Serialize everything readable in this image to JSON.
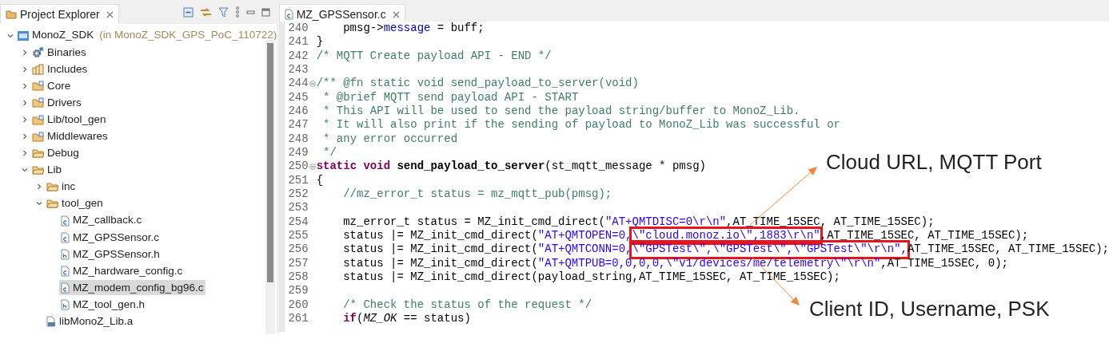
{
  "explorer": {
    "title": "Project Explorer",
    "tree": [
      {
        "name": "MonoZ_SDK",
        "location": "(in MonoZ_SDK_GPS_PoC_110722)",
        "kind": "project",
        "expanded": true,
        "selected": false,
        "children": [
          {
            "name": "Binaries",
            "kind": "binaries",
            "expanded": false,
            "selected": false
          },
          {
            "name": "Includes",
            "kind": "includes",
            "expanded": false,
            "selected": false
          },
          {
            "name": "Core",
            "kind": "sourcefolder",
            "expanded": false,
            "selected": false
          },
          {
            "name": "Drivers",
            "kind": "sourcefolder",
            "expanded": false,
            "selected": false
          },
          {
            "name": "Lib/tool_gen",
            "kind": "sourcefolder",
            "expanded": false,
            "selected": false
          },
          {
            "name": "Middlewares",
            "kind": "sourcefolder",
            "expanded": false,
            "selected": false
          },
          {
            "name": "Debug",
            "kind": "folder",
            "expanded": false,
            "selected": false
          },
          {
            "name": "Lib",
            "kind": "folder",
            "expanded": true,
            "selected": false,
            "children": [
              {
                "name": "inc",
                "kind": "folder",
                "expanded": false,
                "selected": false
              },
              {
                "name": "tool_gen",
                "kind": "folder",
                "expanded": true,
                "selected": false,
                "children": [
                  {
                    "name": "MZ_callback.c",
                    "kind": "source",
                    "selected": false
                  },
                  {
                    "name": "MZ_GPSSensor.c",
                    "kind": "source",
                    "selected": false
                  },
                  {
                    "name": "MZ_GPSSensor.h",
                    "kind": "header",
                    "selected": false
                  },
                  {
                    "name": "MZ_hardware_config.c",
                    "kind": "source",
                    "selected": false
                  },
                  {
                    "name": "MZ_modem_config_bg96.c",
                    "kind": "source",
                    "selected": true
                  },
                  {
                    "name": "MZ_tool_gen.h",
                    "kind": "header",
                    "selected": false
                  }
                ]
              },
              {
                "name": "libMonoZ_Lib.a",
                "kind": "archive",
                "selected": false
              }
            ]
          }
        ]
      }
    ]
  },
  "editor": {
    "tab": "MZ_GPSSensor.c",
    "lines": [
      {
        "number": "240",
        "indented": true,
        "fold": false,
        "tokens": [
          {
            "kind": "plain",
            "text": "pmsg->"
          },
          {
            "kind": "field",
            "text": "message"
          },
          {
            "kind": "plain",
            "text": " = buff;"
          }
        ]
      },
      {
        "number": "241",
        "indented": false,
        "fold": false,
        "tokens": [
          {
            "kind": "plain",
            "text": "}"
          }
        ]
      },
      {
        "number": "242",
        "indented": false,
        "fold": false,
        "tokens": [
          {
            "kind": "comment",
            "text": "/* MQTT Create payload API - END */"
          }
        ]
      },
      {
        "number": "243",
        "indented": false,
        "fold": false
      },
      {
        "number": "244",
        "indented": false,
        "fold": true,
        "tokens": [
          {
            "kind": "comment",
            "text": "/** @fn static void send_payload_to_server(void)"
          }
        ]
      },
      {
        "number": "245",
        "indented": false,
        "fold": false,
        "tokens": [
          {
            "kind": "comment",
            "text": " * @brief MQTT send payload API - START"
          }
        ]
      },
      {
        "number": "246",
        "indented": false,
        "fold": false,
        "tokens": [
          {
            "kind": "comment",
            "text": " * This API will be used to send the payload string/buffer to MonoZ_Lib."
          }
        ]
      },
      {
        "number": "247",
        "indented": false,
        "fold": false,
        "tokens": [
          {
            "kind": "comment",
            "text": " * It will also print if the sending of payload to MonoZ_Lib was successful or"
          }
        ]
      },
      {
        "number": "248",
        "indented": false,
        "fold": false,
        "tokens": [
          {
            "kind": "comment",
            "text": " * any error occurred"
          }
        ]
      },
      {
        "number": "249",
        "indented": false,
        "fold": false,
        "tokens": [
          {
            "kind": "comment",
            "text": " */"
          }
        ]
      },
      {
        "number": "250",
        "indented": false,
        "fold": true,
        "tokens": [
          {
            "kind": "keyword",
            "text": "static "
          },
          {
            "kind": "keyword",
            "text": "void "
          },
          {
            "kind": "declaration",
            "text": "send_payload_to_server"
          },
          {
            "kind": "plain",
            "text": "(st_mqtt_message * pmsg)"
          }
        ]
      },
      {
        "number": "251",
        "indented": false,
        "fold": false,
        "tokens": [
          {
            "kind": "plain",
            "text": "{"
          }
        ]
      },
      {
        "number": "252",
        "indented": true,
        "fold": false,
        "tokens": [
          {
            "kind": "comment",
            "text": "//mz_error_t status = mz_mqtt_pub(pmsg);"
          }
        ]
      },
      {
        "number": "253",
        "indented": false,
        "fold": false
      },
      {
        "number": "254",
        "indented": true,
        "fold": false,
        "tokens": [
          {
            "kind": "plain",
            "text": "mz_error_t status = MZ_init_cmd_direct("
          },
          {
            "kind": "string",
            "text": "\"AT+QMTDISC=0\\r\\n\""
          },
          {
            "kind": "plain",
            "text": ",AT_TIME_15SEC, AT_TIME_15SEC);"
          }
        ]
      },
      {
        "number": "255",
        "indented": true,
        "fold": false,
        "tokens": [
          {
            "kind": "plain",
            "text": "status |= MZ_init_cmd_direct("
          },
          {
            "kind": "string",
            "text": "\"AT+QMTOPEN=0,"
          },
          {
            "kind": "string",
            "boxed": true,
            "text": "\\\"cloud.monoz.io\\\",1883\\r\\n\""
          },
          {
            "kind": "plain",
            "text": ",AT_TIME_15SEC, AT_TIME_15SEC);"
          }
        ]
      },
      {
        "number": "256",
        "indented": true,
        "fold": false,
        "tokens": [
          {
            "kind": "plain",
            "text": "status |= MZ_init_cmd_direct("
          },
          {
            "kind": "string",
            "text": "\"AT+QMTCONN=0,"
          },
          {
            "kind": "string",
            "boxed": true,
            "text": "\\\"GPSTest\\\",\\\"GPSTest\\\",\\\"GPSTest\\\"\\r\\n\","
          },
          {
            "kind": "plain",
            "text": "AT_TIME_15SEC, AT_TIME_15SEC);"
          }
        ]
      },
      {
        "number": "257",
        "indented": true,
        "fold": false,
        "tokens": [
          {
            "kind": "plain",
            "text": "status |= MZ_init_cmd_direct("
          },
          {
            "kind": "string",
            "text": "\"AT+QMTPUB=0,0,0,0,\\\"v1/devices/me/telemetry\\\"\\r\\n\""
          },
          {
            "kind": "plain",
            "text": ",AT_TIME_15SEC, 0);"
          }
        ]
      },
      {
        "number": "258",
        "indented": true,
        "fold": false,
        "tokens": [
          {
            "kind": "plain",
            "text": "status |= MZ_init_cmd_direct(payload_string,AT_TIME_15SEC, AT_TIME_15SEC);"
          }
        ]
      },
      {
        "number": "259",
        "indented": false,
        "fold": false
      },
      {
        "number": "260",
        "indented": true,
        "fold": false,
        "tokens": [
          {
            "kind": "comment",
            "text": "/* Check the status of the request */"
          }
        ]
      },
      {
        "number": "261",
        "indented": true,
        "fold": false,
        "tokens": [
          {
            "kind": "keyword",
            "text": "if"
          },
          {
            "kind": "plain",
            "text": "("
          },
          {
            "kind": "constant",
            "text": "MZ_OK"
          },
          {
            "kind": "plain",
            "text": " == status)"
          }
        ]
      }
    ]
  },
  "annotations": [
    {
      "text": "Cloud URL, MQTT Port"
    },
    {
      "text": "Client ID, Username, PSK"
    }
  ]
}
